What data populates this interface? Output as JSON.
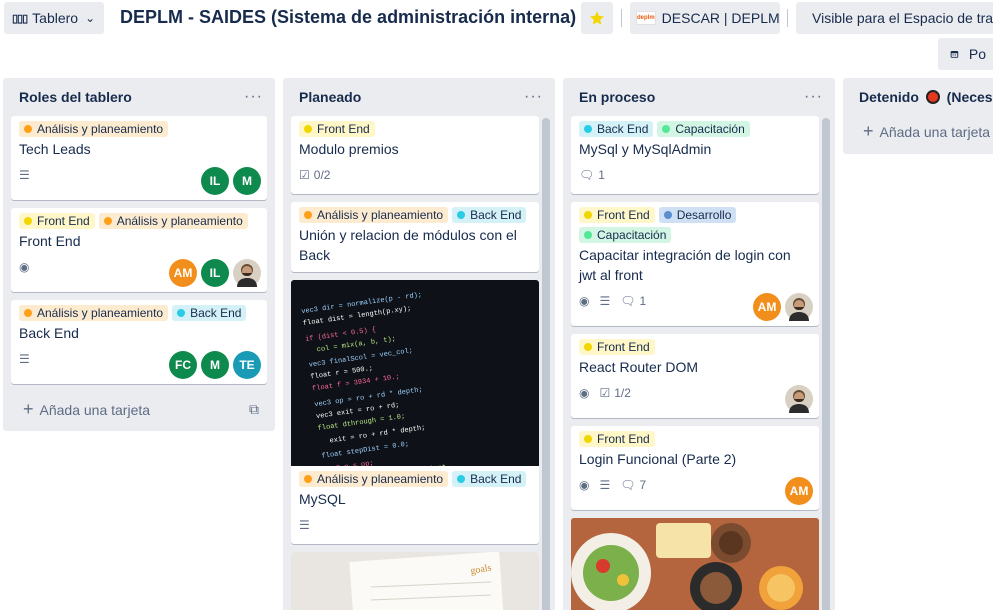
{
  "header": {
    "view_label": "Tablero",
    "view_icon": "board-icon",
    "title": "DEPLM - SAIDES (Sistema de administración interna)",
    "star_icon": "star-icon",
    "workspace": "DESCAR | DEPLM",
    "workspace_logo": "deplm",
    "visibility": "Visible para el Espacio de trabajo",
    "calendar_label": "Po"
  },
  "colors": {
    "analysis": "#fdebd0",
    "analysis_dot": "#ff9f1a",
    "frontend": "#fff7c7",
    "frontend_dot": "#f2d600",
    "backend": "#d5f1f8",
    "backend_dot": "#29cce5",
    "capacitacion": "#d3f5e4",
    "capacitacion_dot": "#51e898",
    "desarrollo": "#cfe0f5",
    "desarrollo_dot": "#5b8dd1",
    "avatar_green": "#0f8a4e",
    "avatar_orange": "#f28f1c",
    "avatar_teal": "#1a9bb5"
  },
  "lists": [
    {
      "title": "Roles del tablero",
      "add_label": "Añada una tarjeta",
      "cards": [
        {
          "labels": [
            "Análisis y planeamiento"
          ],
          "title": "Tech Leads",
          "members": [
            "IL",
            "M"
          ]
        },
        {
          "labels": [
            "Front End",
            "Análisis y planeamiento"
          ],
          "title": "Front End",
          "members": [
            "AM",
            "IL",
            "photo"
          ]
        },
        {
          "labels": [
            "Análisis y planeamiento",
            "Back End"
          ],
          "title": "Back End",
          "members": [
            "FC",
            "M",
            "TE"
          ]
        }
      ]
    },
    {
      "title": "Planeado",
      "cards": [
        {
          "labels": [
            "Front End"
          ],
          "title": "Modulo premios",
          "checklist": "0/2"
        },
        {
          "labels": [
            "Análisis y planeamiento",
            "Back End"
          ],
          "title": "Unión y relacion de módulos con el Back"
        },
        {
          "labels": [
            "Análisis y planeamiento",
            "Back End"
          ],
          "title": "MySQL"
        }
      ]
    },
    {
      "title": "En proceso",
      "cards": [
        {
          "labels": [
            "Back End",
            "Capacitación"
          ],
          "title": "MySql y MySqlAdmin",
          "comments": "1"
        },
        {
          "labels": [
            "Front End",
            "Desarrollo",
            "Capacitación"
          ],
          "title": "Capacitar integración de login con jwt al front",
          "comments": "1",
          "members": [
            "AM",
            "photo"
          ]
        },
        {
          "labels": [
            "Front End"
          ],
          "title": "React Router DOM",
          "checklist": "1/2",
          "members": [
            "photo"
          ]
        },
        {
          "labels": [
            "Front End"
          ],
          "title": "Login Funcional (Parte 2)",
          "comments": "7",
          "members": [
            "AM"
          ]
        }
      ]
    },
    {
      "title": "Detenido",
      "title_suffix": "(Necesita",
      "add_label": "Añada una tarjeta"
    }
  ]
}
